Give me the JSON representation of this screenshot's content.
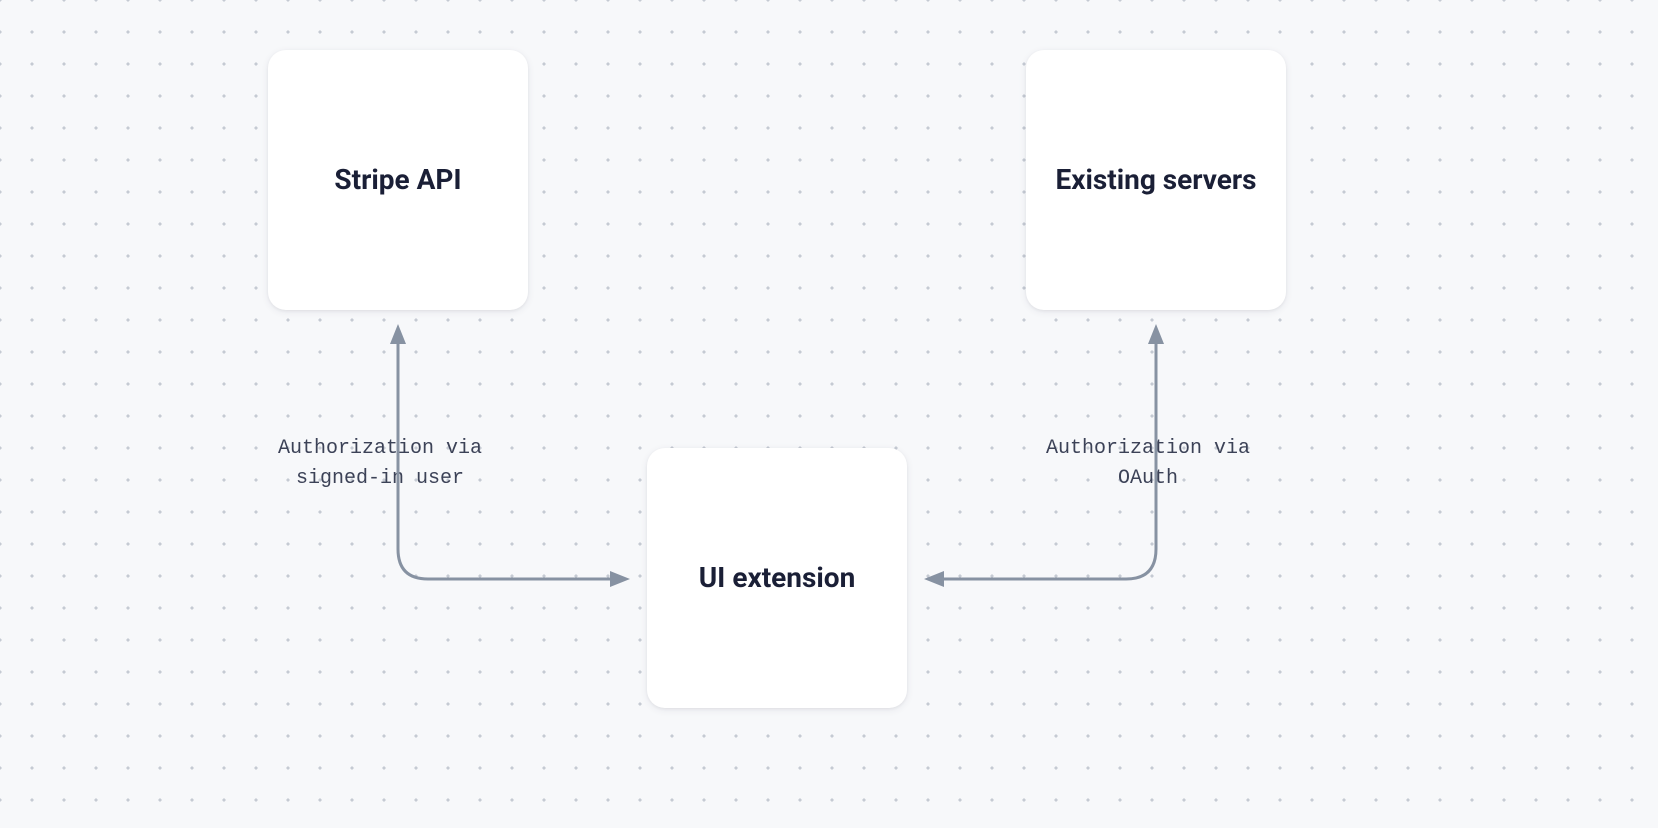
{
  "nodes": {
    "stripe_api": {
      "label": "Stripe API"
    },
    "existing_servers": {
      "label": "Existing\nservers"
    },
    "ui_extension": {
      "label": "UI extension"
    }
  },
  "edges": {
    "left": {
      "label": "Authorization via\nsigned-in user"
    },
    "right": {
      "label": "Authorization via\nOAuth"
    }
  }
}
